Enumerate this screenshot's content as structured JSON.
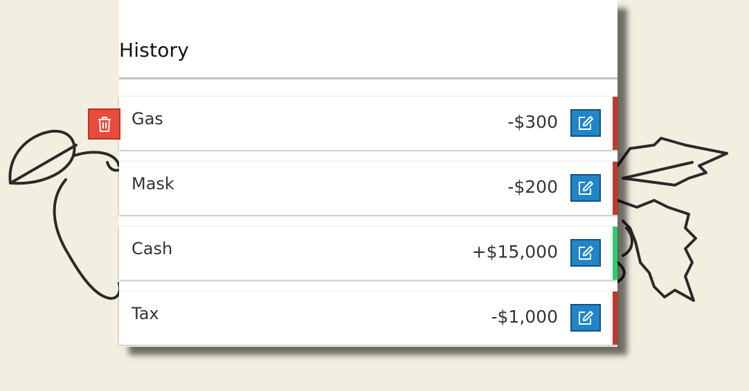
{
  "history": {
    "title": "History"
  },
  "transactions": [
    {
      "name": "Gas",
      "amount": "-$300",
      "type": "expense"
    },
    {
      "name": "Mask",
      "amount": "-$200",
      "type": "expense"
    },
    {
      "name": "Cash",
      "amount": "+$15,000",
      "type": "income"
    },
    {
      "name": "Tax",
      "amount": "-$1,000",
      "type": "expense"
    }
  ],
  "icons": {
    "edit": "edit-icon",
    "delete": "trash-icon"
  },
  "colors": {
    "background": "#f3efe0",
    "expense": "#c0392b",
    "income": "#2ecc71",
    "edit_button": "#2185c9",
    "delete_button": "#e74c3c"
  }
}
